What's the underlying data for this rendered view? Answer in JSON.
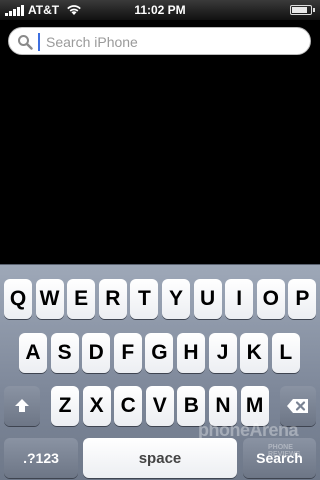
{
  "status_bar": {
    "carrier": "AT&T",
    "time": "11:02 PM",
    "signal_bars": 5,
    "battery_level": 0.85
  },
  "search": {
    "placeholder": "Search iPhone"
  },
  "keyboard": {
    "row1": [
      "Q",
      "W",
      "E",
      "R",
      "T",
      "Y",
      "U",
      "I",
      "O",
      "P"
    ],
    "row2": [
      "A",
      "S",
      "D",
      "F",
      "G",
      "H",
      "J",
      "K",
      "L"
    ],
    "row3": [
      "Z",
      "X",
      "C",
      "V",
      "B",
      "N",
      "M"
    ],
    "numbers_label": ".?123",
    "space_label": "space",
    "search_label": "Search"
  },
  "watermark": {
    "text": "phoneArena",
    "sub": "PHONE REVIEWS"
  },
  "icons": [
    "signal-icon",
    "wifi-icon",
    "battery-icon",
    "search-icon",
    "shift-icon",
    "backspace-icon"
  ]
}
